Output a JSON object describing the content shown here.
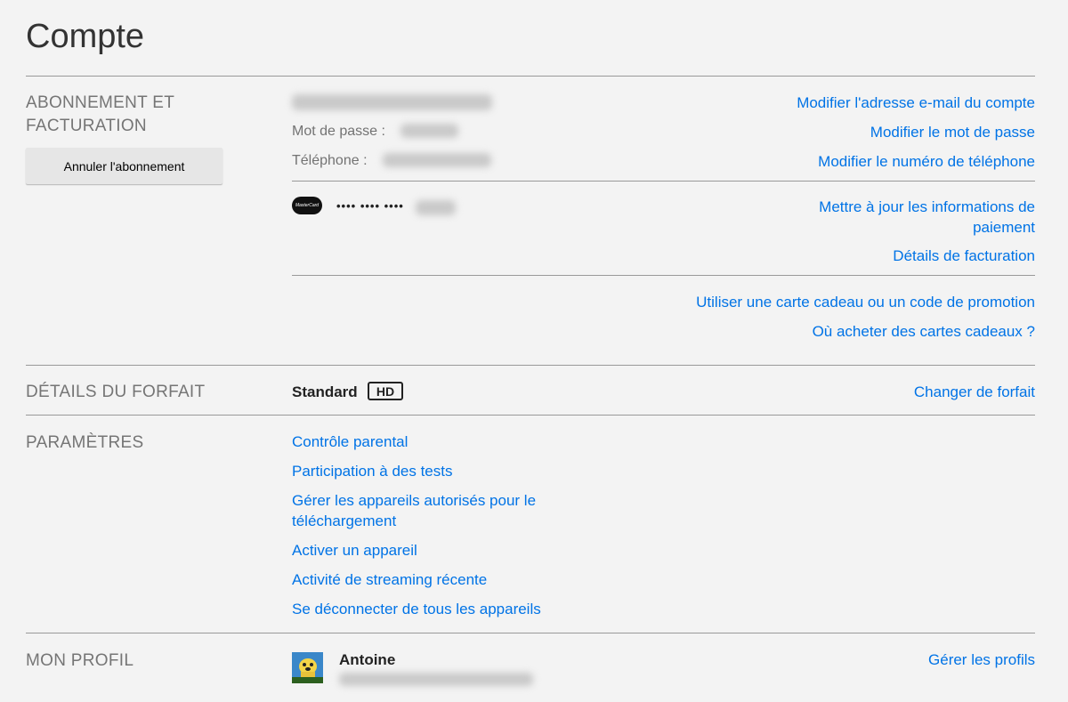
{
  "page": {
    "title": "Compte"
  },
  "membership": {
    "label_line1": "ABONNEMENT ET",
    "label_line2": "FACTURATION",
    "cancel_label": "Annuler l'abonnement",
    "password_label": "Mot de passe :",
    "phone_label": "Téléphone :",
    "links": {
      "change_email": "Modifier l'adresse e-mail du compte",
      "change_password": "Modifier le mot de passe",
      "change_phone": "Modifier le numéro de téléphone",
      "update_payment_line1": "Mettre à jour les informations de",
      "update_payment_line2": "paiement",
      "billing_details": "Détails de facturation",
      "gift_card": "Utiliser une carte cadeau ou un code de promotion",
      "buy_gift": "Où acheter des cartes cadeaux ?"
    },
    "card": {
      "brand": "MasterCard",
      "masked": "•••• •••• ••••"
    }
  },
  "plan": {
    "label": "DÉTAILS DU FORFAIT",
    "name": "Standard",
    "badge": "HD",
    "change_link": "Changer de forfait"
  },
  "settings": {
    "label": "PARAMÈTRES",
    "links": [
      "Contrôle parental",
      "Participation à des tests",
      "Gérer les appareils autorisés pour le",
      "téléchargement",
      "Activer un appareil",
      "Activité de streaming récente",
      "Se déconnecter de tous les appareils"
    ]
  },
  "profile": {
    "label": "MON PROFIL",
    "name": "Antoine",
    "manage_link": "Gérer les profils"
  },
  "colors": {
    "link": "#0073e6",
    "background": "#f3f3f3",
    "avatar": "#3a87c9"
  }
}
